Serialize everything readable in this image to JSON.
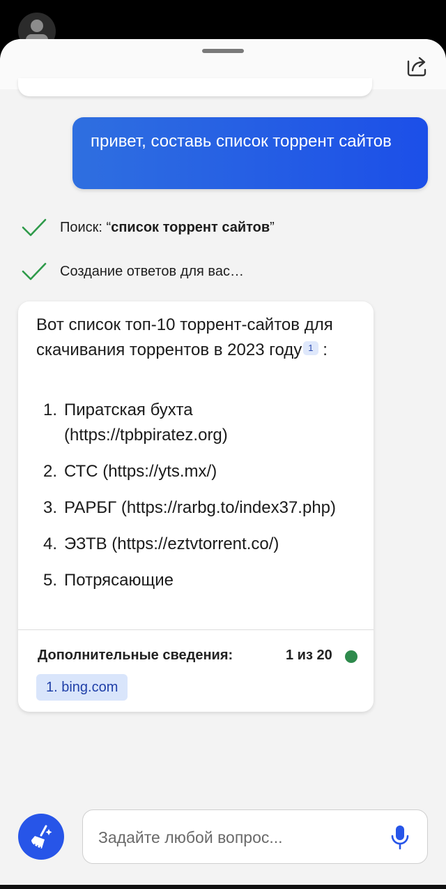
{
  "conversation": {
    "user_message": "привет, составь список торрент сайтов",
    "status": {
      "search_prefix": "Поиск: “",
      "search_query": "список торрент сайтов",
      "search_suffix": "”",
      "generating": "Создание ответов для вас…"
    },
    "answer": {
      "intro": "Вот список топ-10 торрент-сайтов для скачивания торрентов в 2023 году",
      "citation": "1",
      "intro_end": ":",
      "items": [
        {
          "num": "1.",
          "text": "Пиратская бухта (https://tpbpiratez.org)"
        },
        {
          "num": "2.",
          "text": "СТС (https://yts.mx/)"
        },
        {
          "num": "3.",
          "text": "РАРБГ (https://rarbg.to/index37.php)"
        },
        {
          "num": "4.",
          "text": "ЭЗТВ (https://eztvtorrent.co/)"
        },
        {
          "num": "5.",
          "text": "Потрясающие"
        }
      ],
      "more_info_label": "Дополнительные сведения:",
      "page_count": "1 из 20",
      "sources": [
        {
          "label": "1. bing.com"
        }
      ]
    }
  },
  "composer": {
    "placeholder": "Задайте любой вопрос..."
  },
  "colors": {
    "accent": "#2755e8",
    "status_dot": "#2e8a4c",
    "check": "#2e9a4a"
  }
}
